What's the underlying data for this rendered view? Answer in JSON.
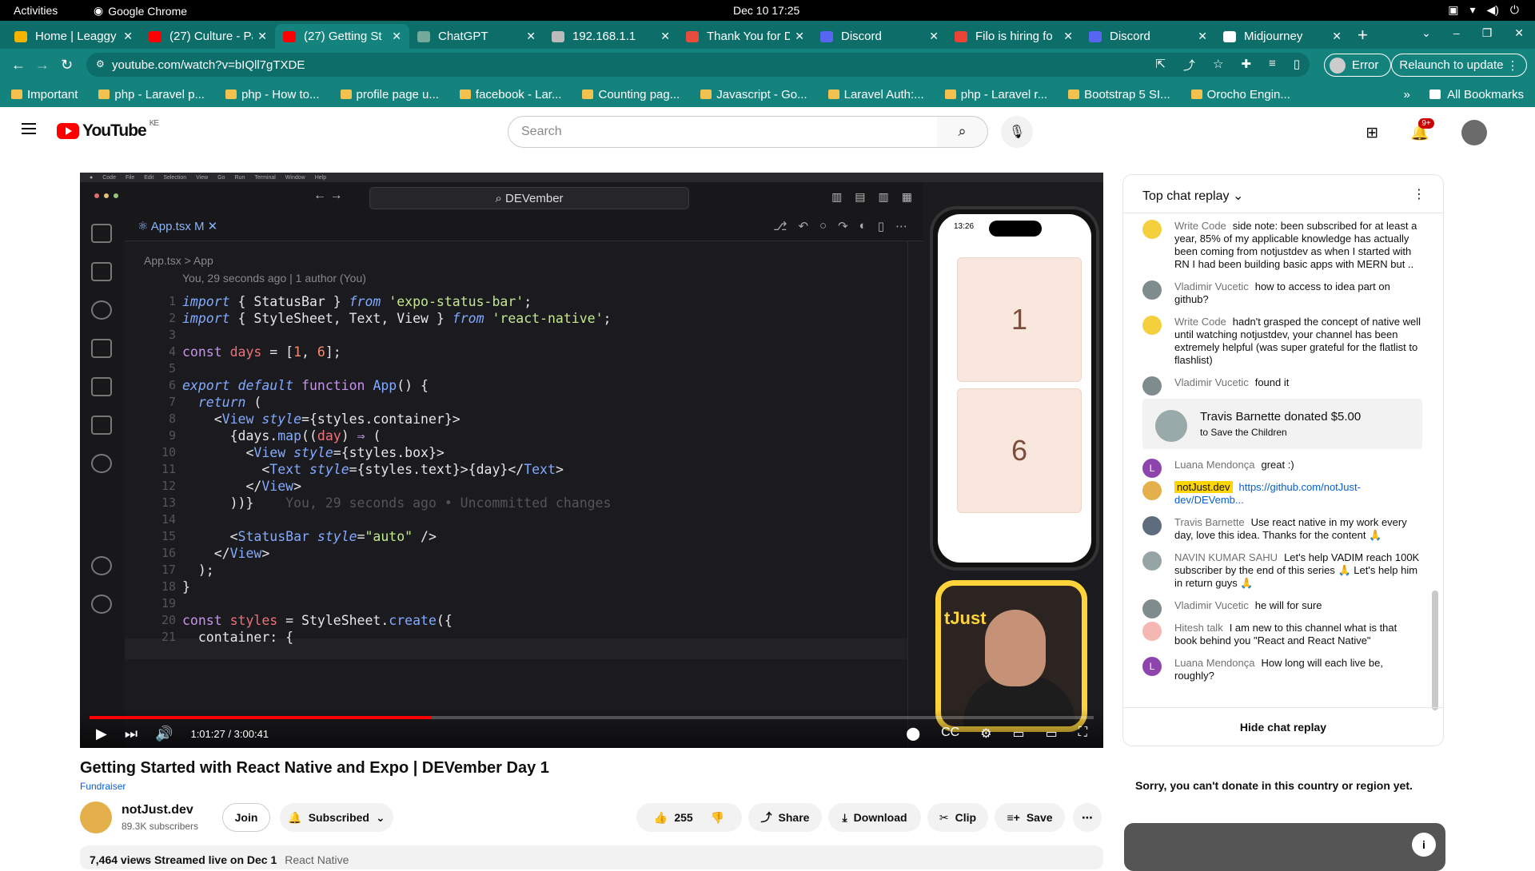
{
  "os": {
    "activities": "Activities",
    "app": "Google Chrome",
    "clock": "Dec 10  17:25"
  },
  "tabs": [
    {
      "label": "Home | Leaggy",
      "color": "#f4b400",
      "active": false
    },
    {
      "label": "(27) Culture - Pa",
      "color": "#ff0000",
      "active": false
    },
    {
      "label": "(27) Getting St",
      "color": "#ff0000",
      "active": true
    },
    {
      "label": "ChatGPT",
      "color": "#74aa9c",
      "active": false
    },
    {
      "label": "192.168.1.1",
      "color": "#bbbbbb",
      "active": false
    },
    {
      "label": "Thank You for D",
      "color": "#e74c3c",
      "active": false
    },
    {
      "label": "Discord",
      "color": "#5865f2",
      "active": false
    },
    {
      "label": "Filo is hiring fo",
      "color": "#ea4335",
      "active": false
    },
    {
      "label": "Discord",
      "color": "#5865f2",
      "active": false
    },
    {
      "label": "Midjourney",
      "color": "#ffffff",
      "active": false
    }
  ],
  "address": {
    "url": "youtube.com/watch?v=bIQll7gTXDE",
    "error": "Error",
    "relaunch": "Relaunch to update"
  },
  "bookmarks": [
    "Important",
    "php - Laravel p...",
    "php - How to...",
    "profile page u...",
    "facebook - Lar...",
    "Counting pag...",
    "Javascript - Go...",
    "Laravel Auth:...",
    "php - Laravel r...",
    "Bootstrap 5 SI...",
    "Orocho Engin..."
  ],
  "bookmarks_all": "All Bookmarks",
  "youtube": {
    "region": "KE",
    "search_placeholder": "Search",
    "notif_count": "9+"
  },
  "editor": {
    "search": "DEVember",
    "tab": "App.tsx  M",
    "breadcrumb": "App.tsx  >  App",
    "blame": "You, 29 seconds ago | 1 author (You)",
    "ghost": "You, 29 seconds ago • Uncommitted changes",
    "lines": [
      "1",
      "2",
      "3",
      "4",
      "5",
      "6",
      "7",
      "8",
      "9",
      "10",
      "11",
      "12",
      "13",
      "14",
      "15",
      "16",
      "17",
      "18",
      "19",
      "20",
      "21"
    ]
  },
  "phone": {
    "time": "13:26",
    "boxes": [
      "1",
      "6"
    ]
  },
  "player": {
    "time": "1:01:27 / 3:00:41",
    "progress": 0.34
  },
  "video": {
    "title": "Getting Started with React Native and Expo | DEVember Day 1",
    "fundraiser": "Fundraiser",
    "channel": "notJust.dev",
    "subscribers": "89.3K subscribers",
    "join": "Join",
    "subscribed": "Subscribed",
    "likes": "255",
    "share": "Share",
    "download": "Download",
    "clip": "Clip",
    "save": "Save",
    "views": "7,464 views  Streamed live on Dec 1",
    "tag": "React Native"
  },
  "chat": {
    "header": "Top chat replay",
    "hide": "Hide chat replay",
    "sorry": "Sorry, you can't donate in this country or region yet.",
    "messages": [
      {
        "author": "Write Code",
        "text": "side note: been subscribed for at least a year, 85% of my applicable knowledge has actually been coming from notjustdev as when I started with RN I had been building basic apps with MERN but ..",
        "color": "#f4d03f"
      },
      {
        "author": "Vladimir Vucetic",
        "text": "how to access to idea part on github?",
        "color": "#7f8c8d"
      },
      {
        "author": "Write Code",
        "text": "hadn't grasped the concept of native well until watching notjustdev, your channel has been extremely helpful (was super grateful for the flatlist to flashlist)",
        "color": "#f4d03f"
      },
      {
        "author": "Vladimir Vucetic",
        "text": "found it",
        "color": "#7f8c8d"
      }
    ],
    "donation": {
      "name": "Travis Barnette donated $5.00",
      "cause": "to Save the Children"
    },
    "messages2": [
      {
        "author": "Luana Mendonça",
        "text": "great :)",
        "color": "#8e44ad",
        "initial": "L"
      },
      {
        "author": "Travis Barnette",
        "text": "Use react native in my work every day, love this idea. Thanks for the content 🙏",
        "color": "#5d6d7e",
        "initial": ""
      },
      {
        "author": "NAVIN KUMAR SAHU",
        "text": "Let's help VADIM reach 100K subscriber by the end of this series 🙏 Let's help him in return guys 🙏",
        "color": "#95a5a6",
        "initial": ""
      },
      {
        "author": "Vladimir Vucetic",
        "text": "he will for sure",
        "color": "#7f8c8d",
        "initial": ""
      },
      {
        "author": "Hitesh talk",
        "text": "I am new to this channel what is that book behind you \"React and React Native\"",
        "color": "#f5b7b1",
        "initial": ""
      },
      {
        "author": "Luana Mendonça",
        "text": "How long will each live be, roughly?",
        "color": "#8e44ad",
        "initial": "L"
      }
    ],
    "owner": {
      "author": "notJust.dev",
      "link": "https://github.com/notJust-dev/DEVemb..."
    }
  }
}
